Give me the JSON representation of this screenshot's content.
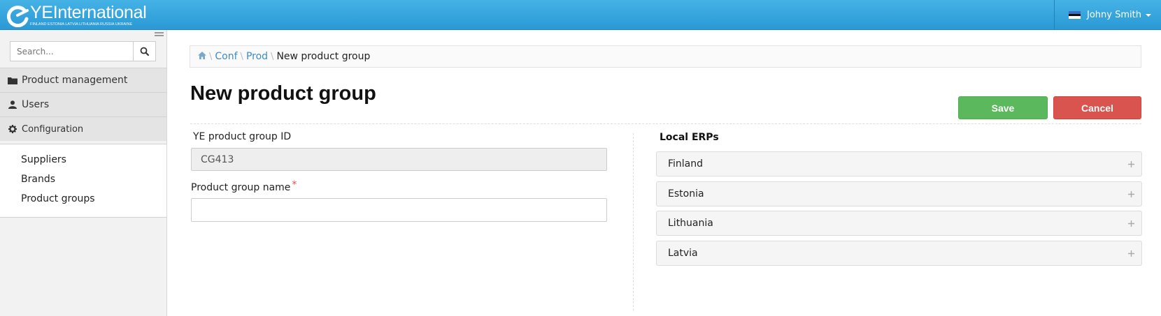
{
  "header": {
    "logo_name": "YEInternational",
    "logo_tagline": "FINLAND  ESTONIA  LATVIA  LITHUANIA  RUSSIA  UKRAINE",
    "user_name": "Johny Smith",
    "brand_color": "#35a6de"
  },
  "sidebar": {
    "search_placeholder": "Search...",
    "nav": [
      {
        "label": "Product management",
        "icon": "folder-icon"
      },
      {
        "label": "Users",
        "icon": "user-icon"
      },
      {
        "label": "Configuration",
        "icon": "gear-icon"
      }
    ],
    "subnav": [
      {
        "label": "Suppliers"
      },
      {
        "label": "Brands"
      },
      {
        "label": "Product groups"
      }
    ]
  },
  "breadcrumb": {
    "items": [
      "Conf",
      "Prod"
    ],
    "current": "New product group"
  },
  "page": {
    "title": "New product group",
    "save_label": "Save",
    "cancel_label": "Cancel"
  },
  "form": {
    "id_label": "YE product group ID",
    "id_value": "CG413",
    "name_label": "Product group name",
    "name_required_mark": "*",
    "name_value": ""
  },
  "erps": {
    "title": "Local ERPs",
    "items": [
      "Finland",
      "Estonia",
      "Lithuania",
      "Latvia"
    ]
  }
}
